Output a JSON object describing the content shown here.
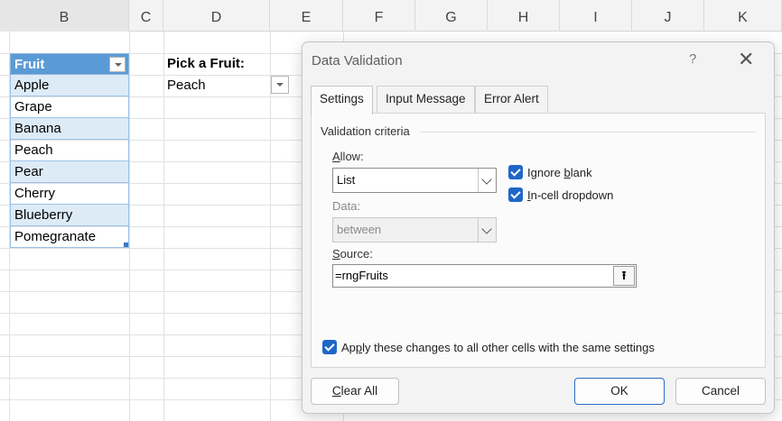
{
  "columns": [
    "B",
    "C",
    "D",
    "E",
    "F",
    "G",
    "H",
    "I",
    "J",
    "K"
  ],
  "table": {
    "header": "Fruit",
    "rows": [
      "Apple",
      "Grape",
      "Banana",
      "Peach",
      "Pear",
      "Cherry",
      "Blueberry",
      "Pomegranate"
    ]
  },
  "picker": {
    "label": "Pick a Fruit:",
    "value": "Peach"
  },
  "dialog": {
    "title": "Data Validation",
    "help": "?",
    "close": "✕",
    "tabs": [
      "Settings",
      "Input Message",
      "Error Alert"
    ],
    "group_title": "Validation criteria",
    "allow_label_pre": "",
    "allow_label_key": "A",
    "allow_label_post": "llow:",
    "allow_value": "List",
    "data_label": "Data:",
    "data_value": "between",
    "source_label_key": "S",
    "source_label_post": "ource:",
    "source_value": "=rngFruits",
    "ignore_blank_pre": "Ignore ",
    "ignore_blank_key": "b",
    "ignore_blank_post": "lank",
    "incell_key": "I",
    "incell_post": "n-cell dropdown",
    "apply_pre": "Ap",
    "apply_key": "p",
    "apply_post": "ly these changes to all other cells with the same settings",
    "clear_key": "C",
    "clear_post": "lear All",
    "ok": "OK",
    "cancel": "Cancel"
  },
  "colors": {
    "table_header": "#5b9bd5",
    "band": "#ddebf7",
    "checkbox": "#1f67c6"
  }
}
